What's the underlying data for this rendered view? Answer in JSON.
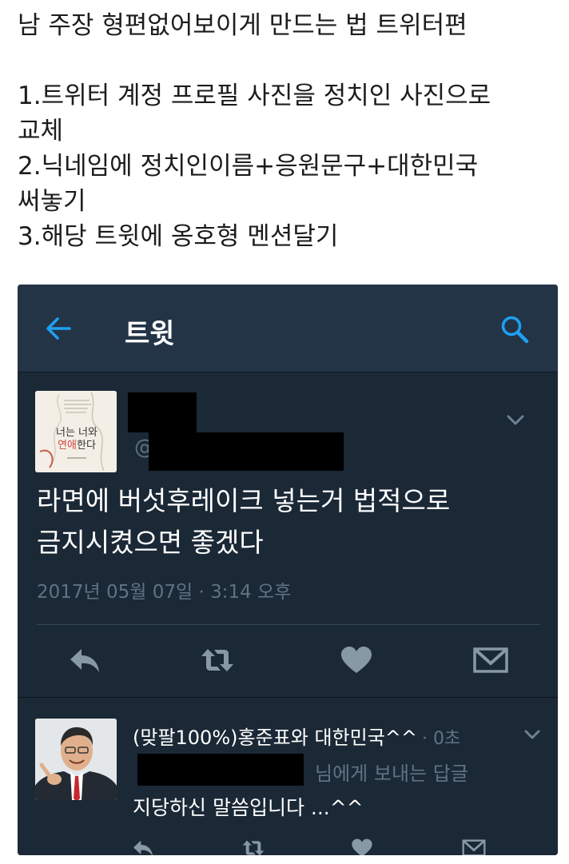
{
  "post": {
    "lines": [
      "남 주장 형편없어보이게 만드는 법 트위터편",
      "1.트위터 계정 프로필 사진을 정치인 사진으로",
      "교체",
      "2.닉네임에 정치인이름+응원문구+대한민국",
      "써놓기",
      "3.해당 트윗에 옹호형 멘션달기"
    ]
  },
  "appbar": {
    "title": "트윗",
    "back_icon": "arrow-left-icon",
    "search_icon": "search-icon"
  },
  "tweet": {
    "handle_prefix": "@",
    "body_line1": "라면에 버섯후레이크 넣는거 법적으로",
    "body_line2": "금지시켰으면 좋겠다",
    "timestamp": "2017년 05월 07일 · 3:14 오후",
    "avatar_text": "너는 너와 연애한다"
  },
  "reply": {
    "name": "(맞팔100%)홍준표와 대한민국^^",
    "time": "· 0초",
    "reply_to_suffix": "님에게 보내는 답글",
    "body": "지당하신 말씀입니다 ...^^"
  },
  "colors": {
    "accent": "#1da1f2",
    "background": "#1b2836",
    "header": "#243447",
    "muted": "#5f7385"
  }
}
